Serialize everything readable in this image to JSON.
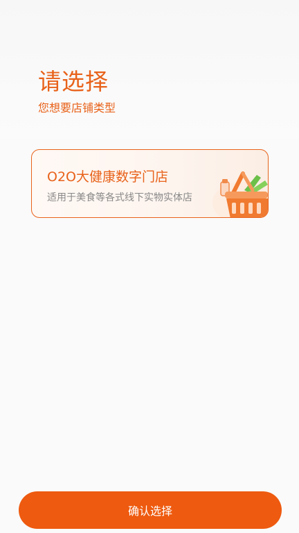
{
  "header": {
    "title": "请选择",
    "subtitle": "您想要店铺类型"
  },
  "store_options": [
    {
      "title": "O2O大健康数字门店",
      "description": "适用于美食等各式线下实物实体店",
      "icon": "shopping-basket-icon"
    }
  ],
  "footer": {
    "confirm_label": "确认选择"
  },
  "colors": {
    "accent": "#e8621a",
    "button": "#ee5a0f",
    "background": "#fafafa"
  }
}
